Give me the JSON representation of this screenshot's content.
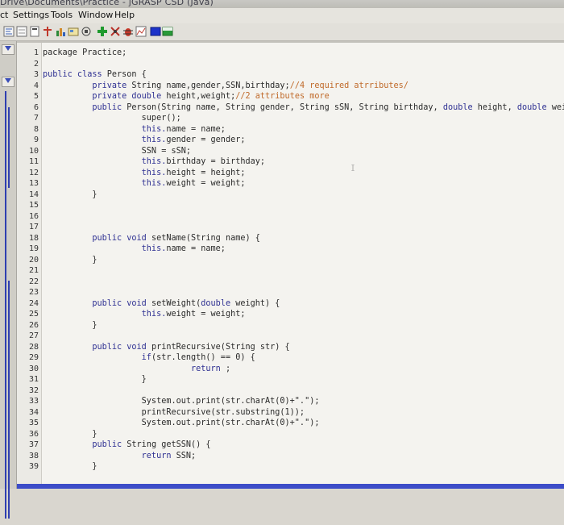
{
  "window": {
    "title": "Drive\\Documents\\Practice - jGRASP CSD (Java)"
  },
  "menu": [
    {
      "name": "menu-project-partial",
      "label": "ct"
    },
    {
      "name": "menu-settings",
      "label": "Settings"
    },
    {
      "name": "menu-tools",
      "label": "Tools"
    },
    {
      "name": "menu-window",
      "label": "Window"
    },
    {
      "name": "menu-help",
      "label": "Help"
    }
  ],
  "toolbar": {
    "icons": [
      "generate-csd-icon",
      "remove-csd-icon",
      "fold-icon",
      "unfold-icon",
      "cpg-icon",
      "browse-icon",
      "add-breakpoint-icon",
      "bug-icon",
      "run-icon",
      "plot-icon",
      "color-a-icon",
      "color-b-icon"
    ]
  },
  "editor": {
    "lines": [
      [
        [
          "package Practice;",
          "t"
        ]
      ],
      [],
      [
        [
          "public class ",
          "k"
        ],
        [
          "Person {",
          "t"
        ]
      ],
      [
        [
          "          private ",
          "k"
        ],
        [
          "String name,gender,SSN,birthday;",
          "t"
        ],
        [
          "//4 required atrributes/",
          "c"
        ]
      ],
      [
        [
          "          private double ",
          "k"
        ],
        [
          "height,weight;",
          "t"
        ],
        [
          "//2 attributes more",
          "c"
        ]
      ],
      [
        [
          "          public ",
          "k"
        ],
        [
          "Person(String name, String gender, String sSN, String birthday, ",
          "t"
        ],
        [
          "double ",
          "k"
        ],
        [
          "height, ",
          "t"
        ],
        [
          "double ",
          "k"
        ],
        [
          "weight)",
          "t"
        ]
      ],
      [
        [
          "                    super();",
          "t"
        ]
      ],
      [
        [
          "                    this.",
          "k"
        ],
        [
          "name = name;",
          "t"
        ]
      ],
      [
        [
          "                    this.",
          "k"
        ],
        [
          "gender = gender;",
          "t"
        ]
      ],
      [
        [
          "                    SSN = sSN;",
          "t"
        ]
      ],
      [
        [
          "                    this.",
          "k"
        ],
        [
          "birthday = birthday;",
          "t"
        ]
      ],
      [
        [
          "                    this.",
          "k"
        ],
        [
          "height = height;",
          "t"
        ]
      ],
      [
        [
          "                    this.",
          "k"
        ],
        [
          "weight = weight;",
          "t"
        ]
      ],
      [
        [
          "          }",
          "t"
        ]
      ],
      [],
      [],
      [],
      [
        [
          "          public void ",
          "k"
        ],
        [
          "setName(String name) {",
          "t"
        ]
      ],
      [
        [
          "                    this.",
          "k"
        ],
        [
          "name = name;",
          "t"
        ]
      ],
      [
        [
          "          }",
          "t"
        ]
      ],
      [],
      [],
      [],
      [
        [
          "          public void ",
          "k"
        ],
        [
          "setWeight(",
          "t"
        ],
        [
          "double ",
          "k"
        ],
        [
          "weight) {",
          "t"
        ]
      ],
      [
        [
          "                    this.",
          "k"
        ],
        [
          "weight = weight;",
          "t"
        ]
      ],
      [
        [
          "          }",
          "t"
        ]
      ],
      [],
      [
        [
          "          public void ",
          "k"
        ],
        [
          "printRecursive(String str) {",
          "t"
        ]
      ],
      [
        [
          "                    if",
          "k"
        ],
        [
          "(str.length() == 0) {",
          "t"
        ]
      ],
      [
        [
          "                              return ",
          "k"
        ],
        [
          ";",
          "t"
        ]
      ],
      [
        [
          "                    }",
          "t"
        ]
      ],
      [],
      [
        [
          "                    System.out.print(str.charAt(0)+\".\");",
          "t"
        ]
      ],
      [
        [
          "                    printRecursive(str.substring(1));",
          "t"
        ]
      ],
      [
        [
          "                    System.out.print(str.charAt(0)+\".\");",
          "t"
        ]
      ],
      [
        [
          "          }",
          "t"
        ]
      ],
      [
        [
          "          public ",
          "k"
        ],
        [
          "String getSSN() {",
          "t"
        ]
      ],
      [
        [
          "                    return ",
          "k"
        ],
        [
          "SSN;",
          "t"
        ]
      ],
      [
        [
          "          }",
          "t"
        ]
      ]
    ]
  }
}
